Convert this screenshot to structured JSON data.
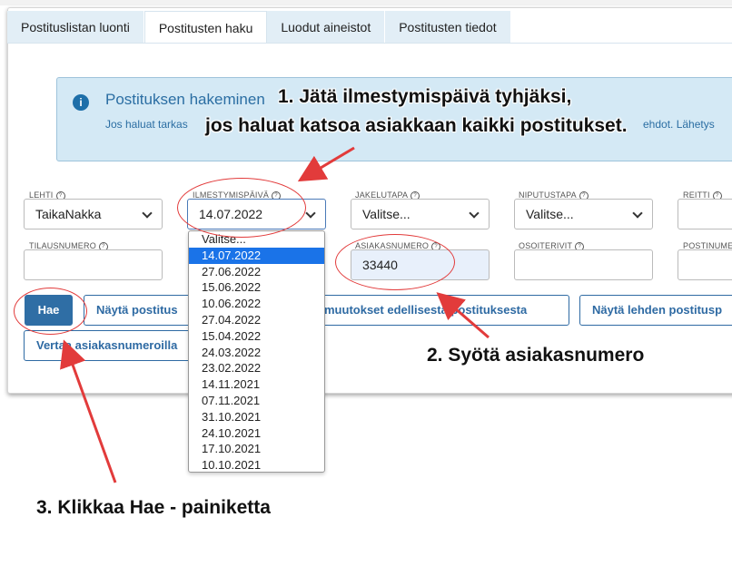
{
  "tabs": [
    {
      "label": "Postituslistan luonti"
    },
    {
      "label": "Postitusten haku"
    },
    {
      "label": "Luodut aineistot"
    },
    {
      "label": "Postitusten tiedot"
    }
  ],
  "info": {
    "icon": "info-icon",
    "title": "Postituksen hakeminen",
    "text": "Jos haluat tarkas",
    "text_tail": "ehdot. Lähetys"
  },
  "form": {
    "lehti": {
      "label": "LEHTI",
      "value": "TaikaNakka"
    },
    "ilmestymispaiva": {
      "label": "ILMESTYMISPÄIVÄ",
      "value": "14.07.2022"
    },
    "jakelutapa": {
      "label": "JAKELUTAPA",
      "value": "Valitse..."
    },
    "niputustapa": {
      "label": "NIPUTUSTAPA",
      "value": "Valitse..."
    },
    "reitti": {
      "label": "REITTI",
      "value": ""
    },
    "tilausnumero": {
      "label": "TILAUSNUMERO",
      "value": ""
    },
    "asiakasnumero": {
      "label": "ASIAKASNUMERO",
      "value": "33440"
    },
    "osoiterivit": {
      "label": "OSOITERIVIT",
      "value": ""
    },
    "postinumero": {
      "label": "POSTINUME",
      "value": ""
    }
  },
  "buttons": {
    "hae": "Hae",
    "nayta_postitus": "Näytä postitus",
    "muutokset": "muutokset edellisestä postituksesta",
    "nayta_lehden": "Näytä lehden postitusp",
    "vertaa": "Vertaa asiakasnumeroilla"
  },
  "date_options": [
    "Valitse...",
    "14.07.2022",
    "27.06.2022",
    "15.06.2022",
    "10.06.2022",
    "27.04.2022",
    "15.04.2022",
    "24.03.2022",
    "23.02.2022",
    "14.11.2021",
    "07.11.2021",
    "31.10.2021",
    "24.10.2021",
    "17.10.2021",
    "10.10.2021"
  ],
  "selected_date_index": 1,
  "annotations": {
    "step1_line1": "1. Jätä ilmestymispäivä tyhjäksi,",
    "step1_line2": "jos haluat katsoa asiakkaan kaikki postitukset.",
    "step2": "2. Syötä asiakasnumero",
    "step3": "3. Klikkaa Hae - painiketta"
  },
  "colors": {
    "accent": "#2f6ea5",
    "annotation_red": "#e23b3b",
    "info_bg": "#d4e9f5",
    "selected_option": "#1a73e8"
  }
}
